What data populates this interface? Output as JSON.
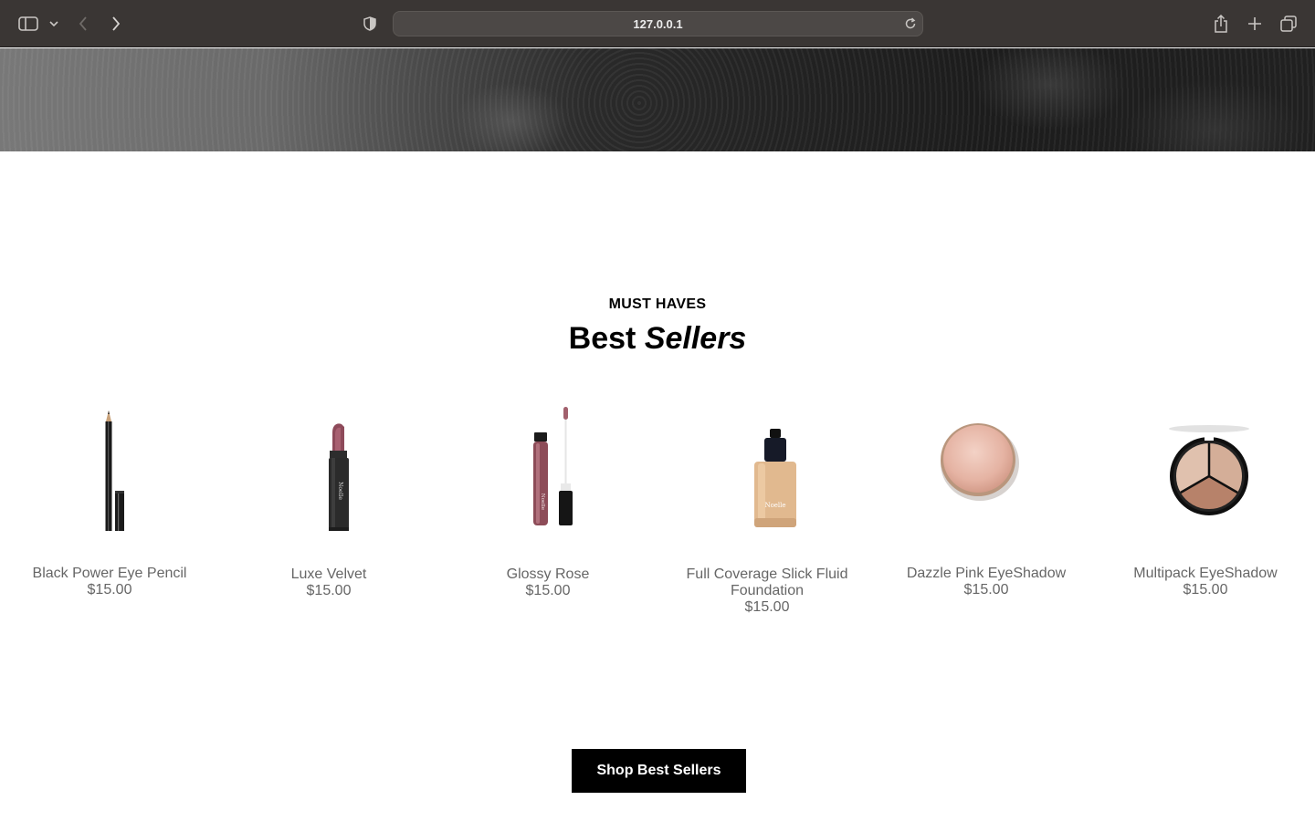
{
  "browser": {
    "url": "127.0.0.1"
  },
  "section": {
    "eyebrow": "MUST HAVES",
    "title_plain": "Best",
    "title_italic": "Sellers"
  },
  "products": [
    {
      "name": "Black Power Eye Pencil",
      "price": "$15.00"
    },
    {
      "name": "Luxe Velvet",
      "price": "$15.00"
    },
    {
      "name": "Glossy Rose",
      "price": "$15.00"
    },
    {
      "name": "Full Coverage Slick Fluid Foundation",
      "price": "$15.00"
    },
    {
      "name": "Dazzle Pink EyeShadow",
      "price": "$15.00"
    },
    {
      "name": "Multipack EyeShadow",
      "price": "$15.00"
    }
  ],
  "cta": {
    "label": "Shop Best Sellers"
  },
  "brand_mark": "Noelle",
  "colors": {
    "chrome_bg": "#3a3634",
    "button_bg": "#000000",
    "product_text": "#666666"
  }
}
